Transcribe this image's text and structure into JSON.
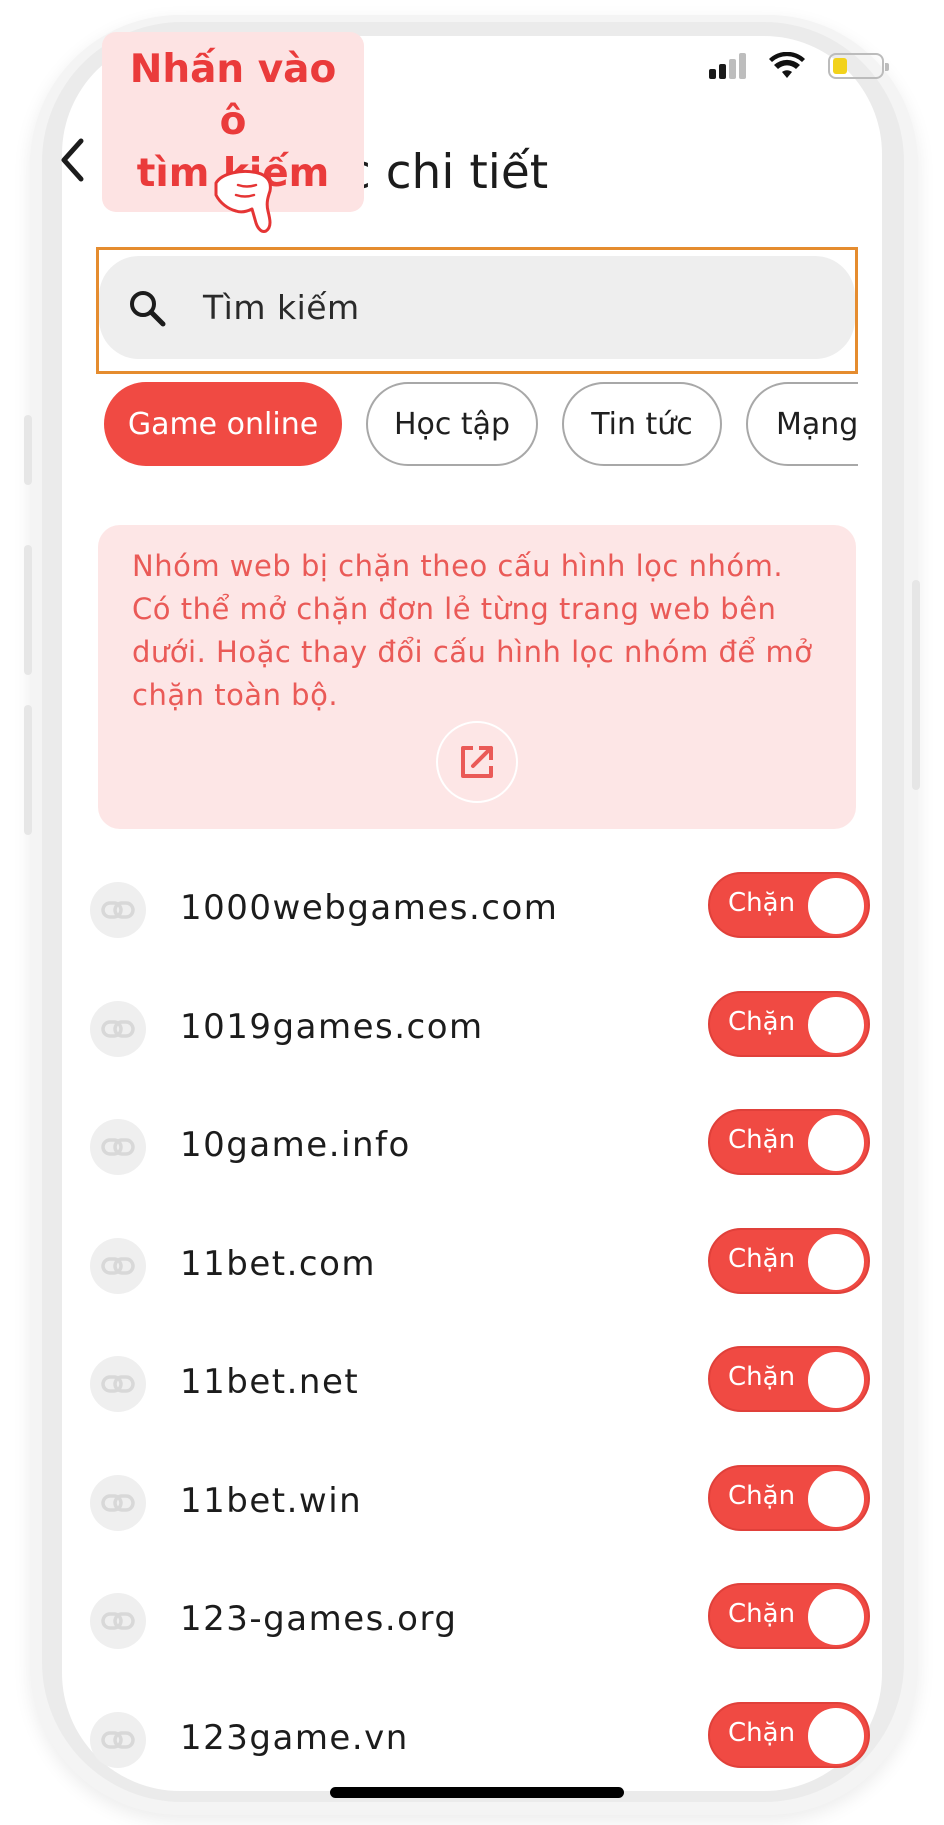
{
  "tooltip": {
    "line1": "Nhấn vào ô",
    "line2": "tìm kiếm"
  },
  "header": {
    "title": "Lọc chi tiết"
  },
  "search": {
    "placeholder": "Tìm kiếm"
  },
  "chips": [
    "Game online",
    "Học tập",
    "Tin tức",
    "Mạng xã hội"
  ],
  "info": {
    "text": "Nhóm web bị chặn theo cấu hình lọc nhóm. Có thể mở chặn đơn lẻ từng trang web bên dưới. Hoặc thay đổi cấu hình lọc nhóm để mở chặn toàn bộ."
  },
  "sites": [
    {
      "domain": "1000webgames.com",
      "toggle_label": "Chặn"
    },
    {
      "domain": "1019games.com",
      "toggle_label": "Chặn"
    },
    {
      "domain": "10game.info",
      "toggle_label": "Chặn"
    },
    {
      "domain": "11bet.com",
      "toggle_label": "Chặn"
    },
    {
      "domain": "11bet.net",
      "toggle_label": "Chặn"
    },
    {
      "domain": "11bet.win",
      "toggle_label": "Chặn"
    },
    {
      "domain": "123-games.org",
      "toggle_label": "Chặn"
    },
    {
      "domain": "123game.vn",
      "toggle_label": "Chặn"
    }
  ],
  "colors": {
    "accent": "#f04a43",
    "highlight": "#e58c2f",
    "battery": "#f2d21b"
  }
}
